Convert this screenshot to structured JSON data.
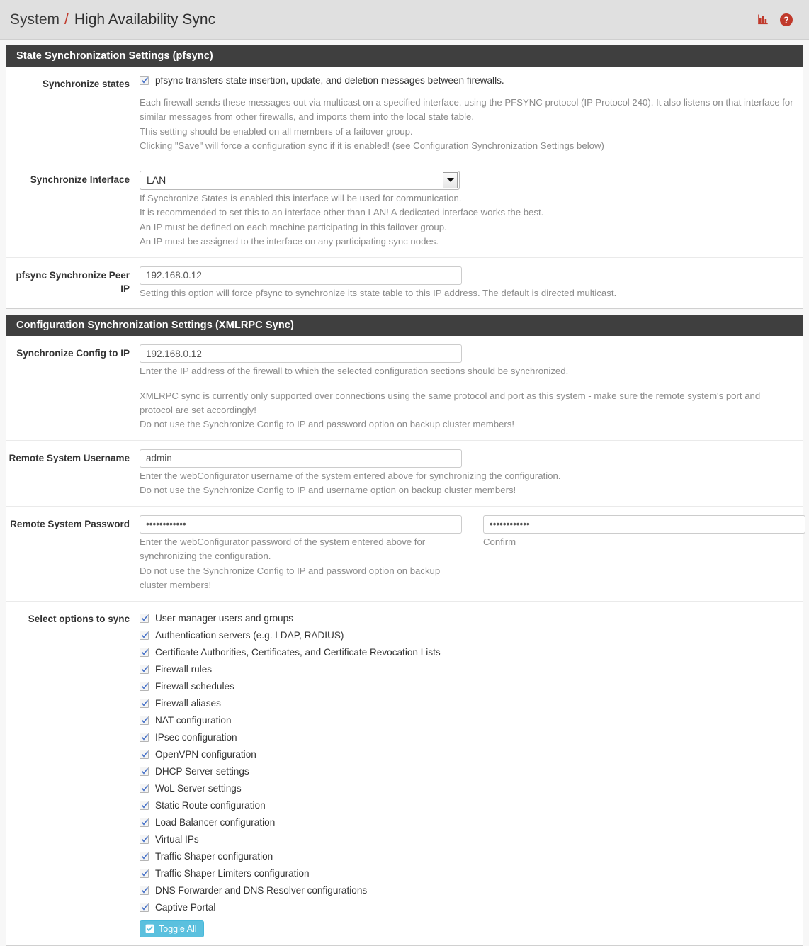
{
  "header": {
    "breadcrumb_root": "System",
    "breadcrumb_separator": "/",
    "breadcrumb_current": "High Availability Sync",
    "icons": [
      {
        "name": "status-chart-icon",
        "label": "Status monitoring"
      },
      {
        "name": "help-icon",
        "label": "Help"
      }
    ],
    "accent_color": "#c0392b"
  },
  "pfsync_section": {
    "title": "State Synchronization Settings (pfsync)",
    "synchronize_states": {
      "label": "Synchronize states",
      "checkbox_label": "pfsync transfers state insertion, update, and deletion messages between firewalls.",
      "checked": true,
      "help_lines": [
        "Each firewall sends these messages out via multicast on a specified interface, using the PFSYNC protocol (IP Protocol 240). It also listens on that interface for similar messages from other firewalls, and imports them into the local state table.",
        "This setting should be enabled on all members of a failover group.",
        "Clicking \"Save\" will force a configuration sync if it is enabled! (see Configuration Synchronization Settings below)"
      ]
    },
    "synchronize_interface": {
      "label": "Synchronize Interface",
      "selected": "LAN",
      "options": [
        "LAN"
      ],
      "help_lines": [
        "If Synchronize States is enabled this interface will be used for communication.",
        "It is recommended to set this to an interface other than LAN! A dedicated interface works the best.",
        "An IP must be defined on each machine participating in this failover group.",
        "An IP must be assigned to the interface on any participating sync nodes."
      ]
    },
    "peer_ip": {
      "label": "pfsync Synchronize Peer IP",
      "value": "192.168.0.12",
      "placeholder": "",
      "help_lines": [
        "Setting this option will force pfsync to synchronize its state table to this IP address. The default is directed multicast."
      ]
    }
  },
  "xmlrpc_section": {
    "title": "Configuration Synchronization Settings (XMLRPC Sync)",
    "sync_config_to_ip": {
      "label": "Synchronize Config to IP",
      "value": "192.168.0.12",
      "placeholder": "",
      "help_lines": [
        "Enter the IP address of the firewall to which the selected configuration sections should be synchronized."
      ],
      "warning_lines": [
        "XMLRPC sync is currently only supported over connections using the same protocol and port as this system - make sure the remote system's port and protocol are set accordingly!",
        "Do not use the Synchronize Config to IP and password option on backup cluster members!"
      ]
    },
    "remote_username": {
      "label": "Remote System Username",
      "value": "admin",
      "placeholder": "",
      "help_lines": [
        "Enter the webConfigurator username of the system entered above for synchronizing the configuration.",
        "Do not use the Synchronize Config to IP and username option on backup cluster members!"
      ]
    },
    "remote_password": {
      "label": "Remote System Password",
      "value": "••••••••••••",
      "confirm_value": "••••••••••••",
      "confirm_label": "Confirm",
      "help_lines": [
        "Enter the webConfigurator password of the system entered above for synchronizing the configuration.",
        "Do not use the Synchronize Config to IP and password option on backup cluster members!"
      ]
    },
    "sync_options": {
      "label": "Select options to sync",
      "items": [
        {
          "label": "User manager users and groups",
          "checked": true
        },
        {
          "label": "Authentication servers (e.g. LDAP, RADIUS)",
          "checked": true
        },
        {
          "label": "Certificate Authorities, Certificates, and Certificate Revocation Lists",
          "checked": true
        },
        {
          "label": "Firewall rules",
          "checked": true
        },
        {
          "label": "Firewall schedules",
          "checked": true
        },
        {
          "label": "Firewall aliases",
          "checked": true
        },
        {
          "label": "NAT configuration",
          "checked": true
        },
        {
          "label": "IPsec configuration",
          "checked": true
        },
        {
          "label": "OpenVPN configuration",
          "checked": true
        },
        {
          "label": "DHCP Server settings",
          "checked": true
        },
        {
          "label": "WoL Server settings",
          "checked": true
        },
        {
          "label": "Static Route configuration",
          "checked": true
        },
        {
          "label": "Load Balancer configuration",
          "checked": true
        },
        {
          "label": "Virtual IPs",
          "checked": true
        },
        {
          "label": "Traffic Shaper configuration",
          "checked": true
        },
        {
          "label": "Traffic Shaper Limiters configuration",
          "checked": true
        },
        {
          "label": "DNS Forwarder and DNS Resolver configurations",
          "checked": true
        },
        {
          "label": "Captive Portal",
          "checked": true
        }
      ],
      "toggle_all_label": "Toggle All"
    }
  }
}
